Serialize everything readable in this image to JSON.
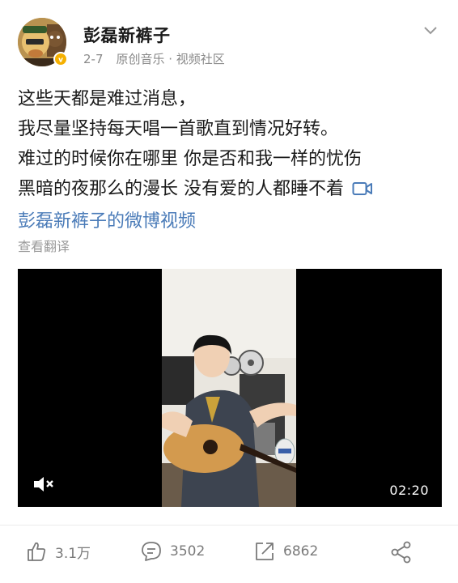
{
  "post": {
    "author": "彭磊新裤子",
    "date": "2-7",
    "source": "原创音乐 · 视频社区",
    "text_lines": [
      "这些天都是难过消息，",
      "我尽量坚持每天唱一首歌直到情况好转。",
      "难过的时候你在哪里 你是否和我一样的忧伤",
      "黑暗的夜那么的漫长 没有爱的人都睡不着"
    ],
    "video_link_label": "彭磊新裤子的微博视频",
    "translate_label": "查看翻译"
  },
  "video": {
    "duration": "02:20",
    "muted": true
  },
  "actions": {
    "likes": "3.1万",
    "comments": "3502",
    "reposts": "6862"
  },
  "icons": {
    "chevron": "chevron-down-icon",
    "verified": "verified-badge-icon",
    "video_link": "video-camera-icon",
    "mute": "muted-speaker-icon",
    "like": "thumbs-up-icon",
    "comment": "comment-bubble-icon",
    "repost": "repost-icon",
    "share": "share-icon"
  },
  "colors": {
    "link": "#4a7bb8",
    "verified": "#f5b000",
    "muted_text": "#8a8a8a"
  }
}
